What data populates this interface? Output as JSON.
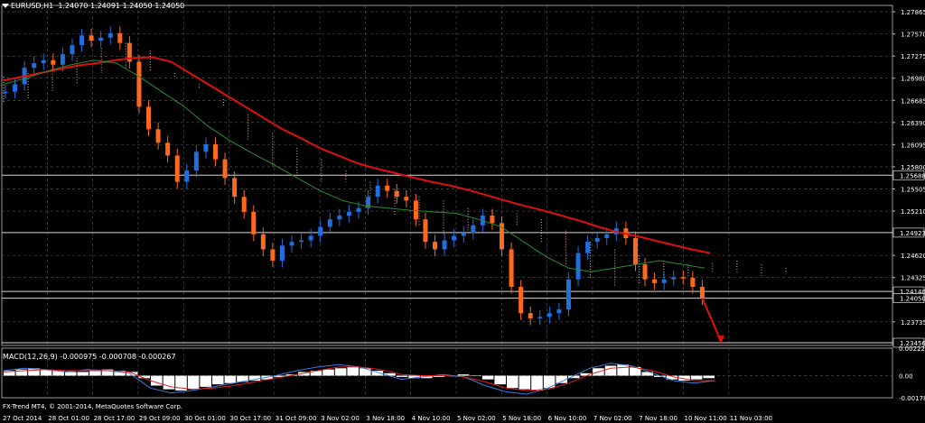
{
  "header": {
    "symbol": "EURUSD,H1",
    "ohlc": "1.24070 1.24091 1.24050 1.24050"
  },
  "macd_label": "MACD(12,26,9) -0.000975 -0.000708 -0.000267",
  "copyright": "FX-Trend MT4, © 2001-2014, MetaQuotes Software Corp.",
  "colors": {
    "background": "#000000",
    "grid": "#5a5a5a",
    "bull_candle": "#1e6fe0",
    "bear_candle": "#ff6a1a",
    "ma_fast": "#2e8b2e",
    "ma_slow": "#e01010",
    "cloud": "#e0b090",
    "macd_line": "#3a7de0",
    "macd_signal": "#e02020",
    "histogram": "#ffffff"
  },
  "chart_data": {
    "type": "candlestick",
    "price_axis_ticks": [
      "1.27865",
      "1.27570",
      "1.27275",
      "1.26980",
      "1.26685",
      "1.26390",
      "1.26095",
      "1.25800",
      "1.25505",
      "1.25210",
      "1.24620",
      "1.24325",
      "1.23735"
    ],
    "price_markers": [
      {
        "label": "1.25688",
        "value": 1.25688
      },
      {
        "label": "1.24923",
        "value": 1.24923
      },
      {
        "label": "1.24140",
        "value": 1.2414
      },
      {
        "label": "1.24050",
        "value": 1.2405
      },
      {
        "label": "1.23456",
        "value": 1.23456
      }
    ],
    "ylim": [
      1.2342,
      1.2795
    ],
    "time_axis_labels": [
      "27 Oct 2014",
      "28 Oct 01:00",
      "28 Oct 17:00",
      "29 Oct 09:00",
      "30 Oct 01:00",
      "30 Oct 17:00",
      "31 Oct 09:00",
      "3 Nov 02:00",
      "3 Nov 18:00",
      "4 Nov 10:00",
      "5 Nov 02:00",
      "5 Nov 18:00",
      "6 Nov 10:00",
      "7 Nov 02:00",
      "7 Nov 18:00",
      "10 Nov 11:00",
      "11 Nov 03:00"
    ],
    "close_series": [
      1.268,
      1.269,
      1.2712,
      1.2718,
      1.2722,
      1.2716,
      1.273,
      1.2742,
      1.2755,
      1.2748,
      1.2752,
      1.2758,
      1.2745,
      1.272,
      1.266,
      1.263,
      1.2612,
      1.2595,
      1.256,
      1.2575,
      1.26,
      1.261,
      1.259,
      1.2565,
      1.254,
      1.252,
      1.249,
      1.247,
      1.2455,
      1.2475,
      1.248,
      1.2482,
      1.2488,
      1.25,
      1.251,
      1.2515,
      1.252,
      1.2525,
      1.254,
      1.2555,
      1.2548,
      1.254,
      1.2535,
      1.251,
      1.248,
      1.247,
      1.2482,
      1.2488,
      1.2492,
      1.2502,
      1.2515,
      1.2505,
      1.247,
      1.242,
      1.2385,
      1.2378,
      1.238,
      1.2385,
      1.239,
      1.243,
      1.2465,
      1.248,
      1.2485,
      1.249,
      1.2498,
      1.2485,
      1.245,
      1.243,
      1.2425,
      1.243,
      1.2433,
      1.2432,
      1.242,
      1.2405
    ],
    "ma_slow_series": [
      1.2695,
      1.27,
      1.2705,
      1.271,
      1.2715,
      1.2718,
      1.2722,
      1.2725,
      1.2726,
      1.272,
      1.2705,
      1.269,
      1.2675,
      1.266,
      1.2645,
      1.263,
      1.2618,
      1.2605,
      1.2595,
      1.2585,
      1.2578,
      1.2572,
      1.2566,
      1.256,
      1.2555,
      1.2549,
      1.2542,
      1.2535,
      1.2528,
      1.2522,
      1.2515,
      1.2508,
      1.25,
      1.2493,
      1.2488,
      1.2482,
      1.2476,
      1.247,
      1.2465
    ],
    "ma_fast_series": [
      1.269,
      1.2698,
      1.2708,
      1.2716,
      1.2722,
      1.2718,
      1.27,
      1.268,
      1.266,
      1.2635,
      1.2615,
      1.2598,
      1.2582,
      1.2565,
      1.2548,
      1.2535,
      1.2528,
      1.2525,
      1.2522,
      1.252,
      1.2518,
      1.251,
      1.25,
      1.248,
      1.246,
      1.2445,
      1.244,
      1.2445,
      1.245,
      1.2455,
      1.245,
      1.2445
    ],
    "cloud_upper": [
      1.27,
      1.2705,
      1.2715,
      1.2725,
      1.2738,
      1.2745,
      1.2735,
      1.2705,
      1.269,
      1.267,
      1.265,
      1.2625,
      1.2605,
      1.259,
      1.2575,
      1.256,
      1.255,
      1.254,
      1.2535,
      1.2525,
      1.2522,
      1.2518,
      1.251,
      1.2495,
      1.248,
      1.247,
      1.2462,
      1.2455,
      1.245,
      1.2452,
      1.2455,
      1.245,
      1.2445
    ],
    "cloud_lower": [
      1.2665,
      1.267,
      1.268,
      1.269,
      1.2705,
      1.2712,
      1.2708,
      1.27,
      1.2685,
      1.266,
      1.2615,
      1.258,
      1.2565,
      1.256,
      1.256,
      1.2535,
      1.2515,
      1.25,
      1.249,
      1.2495,
      1.2505,
      1.25,
      1.248,
      1.245,
      1.243,
      1.242,
      1.2422,
      1.2428,
      1.2432,
      1.2438,
      1.244,
      1.2435,
      1.244
    ],
    "macd": {
      "axis_ticks": [
        "0.002226",
        "0.00",
        "-0.001784"
      ],
      "ylim": [
        -0.001784,
        0.002226
      ],
      "histogram": [
        0.0004,
        0.0005,
        0.0006,
        0.0005,
        0.0004,
        0.0003,
        0.0003,
        0.0004,
        0.0005,
        0.0004,
        0.0003,
        -0.0002,
        -0.0008,
        -0.0011,
        -0.0012,
        -0.0011,
        -0.0009,
        -0.0007,
        -0.0006,
        -0.0005,
        -0.0004,
        -0.0003,
        -0.0001,
        0.0001,
        0.0003,
        0.0004,
        0.0005,
        0.0006,
        0.0007,
        0.0006,
        0.0004,
        0.0002,
        -0.0001,
        -0.0002,
        -0.0002,
        -0.0001,
        0.0,
        0.0001,
        0.0,
        -0.0003,
        -0.0007,
        -0.001,
        -0.0011,
        -0.0012,
        -0.001,
        -0.0006,
        -0.0002,
        0.0002,
        0.0006,
        0.0008,
        0.0009,
        0.0007,
        0.0003,
        -0.0001,
        -0.0003,
        -0.0004,
        -0.0003,
        -0.0002
      ],
      "line": [
        0.0004,
        0.0006,
        0.0005,
        0.0003,
        0.0005,
        0.0004,
        0.0002,
        -0.001,
        -0.0014,
        -0.0012,
        -0.0009,
        -0.0006,
        -0.0003,
        0.0,
        0.0004,
        0.0007,
        0.0009,
        0.0007,
        0.0002,
        -0.0003,
        -0.0001,
        0.0001,
        -0.0001,
        -0.0008,
        -0.0013,
        -0.0015,
        -0.001,
        -0.0002,
        0.0006,
        0.001,
        0.0008,
        0.0002,
        -0.0004,
        -0.0006,
        -0.0004
      ],
      "signal": [
        0.0003,
        0.0004,
        0.0005,
        0.0004,
        0.0004,
        0.0004,
        0.0003,
        -0.0004,
        -0.0009,
        -0.0011,
        -0.001,
        -0.0008,
        -0.0005,
        -0.0002,
        0.0001,
        0.0004,
        0.0007,
        0.0007,
        0.0005,
        0.0001,
        0.0,
        0.0,
        -0.0001,
        -0.0005,
        -0.001,
        -0.0012,
        -0.0011,
        -0.0006,
        0.0001,
        0.0006,
        0.0007,
        0.0004,
        -0.0001,
        -0.0004,
        -0.0004
      ]
    }
  }
}
